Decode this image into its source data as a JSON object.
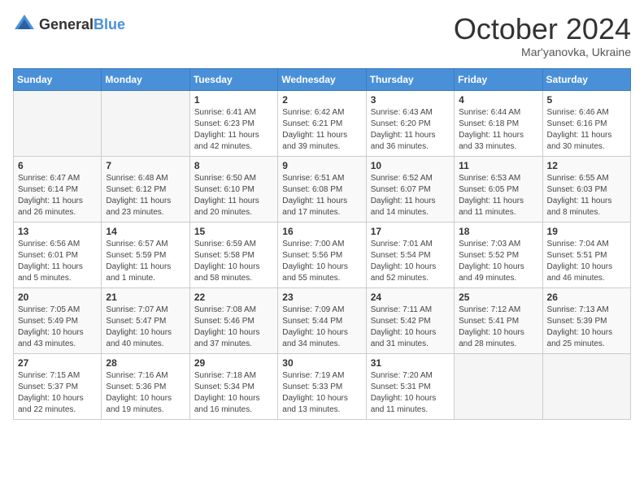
{
  "header": {
    "logo_general": "General",
    "logo_blue": "Blue",
    "month": "October 2024",
    "location": "Mar'yanovka, Ukraine"
  },
  "weekdays": [
    "Sunday",
    "Monday",
    "Tuesday",
    "Wednesday",
    "Thursday",
    "Friday",
    "Saturday"
  ],
  "weeks": [
    [
      {
        "day": "",
        "sunrise": "",
        "sunset": "",
        "daylight": ""
      },
      {
        "day": "",
        "sunrise": "",
        "sunset": "",
        "daylight": ""
      },
      {
        "day": "1",
        "sunrise": "Sunrise: 6:41 AM",
        "sunset": "Sunset: 6:23 PM",
        "daylight": "Daylight: 11 hours and 42 minutes."
      },
      {
        "day": "2",
        "sunrise": "Sunrise: 6:42 AM",
        "sunset": "Sunset: 6:21 PM",
        "daylight": "Daylight: 11 hours and 39 minutes."
      },
      {
        "day": "3",
        "sunrise": "Sunrise: 6:43 AM",
        "sunset": "Sunset: 6:20 PM",
        "daylight": "Daylight: 11 hours and 36 minutes."
      },
      {
        "day": "4",
        "sunrise": "Sunrise: 6:44 AM",
        "sunset": "Sunset: 6:18 PM",
        "daylight": "Daylight: 11 hours and 33 minutes."
      },
      {
        "day": "5",
        "sunrise": "Sunrise: 6:46 AM",
        "sunset": "Sunset: 6:16 PM",
        "daylight": "Daylight: 11 hours and 30 minutes."
      }
    ],
    [
      {
        "day": "6",
        "sunrise": "Sunrise: 6:47 AM",
        "sunset": "Sunset: 6:14 PM",
        "daylight": "Daylight: 11 hours and 26 minutes."
      },
      {
        "day": "7",
        "sunrise": "Sunrise: 6:48 AM",
        "sunset": "Sunset: 6:12 PM",
        "daylight": "Daylight: 11 hours and 23 minutes."
      },
      {
        "day": "8",
        "sunrise": "Sunrise: 6:50 AM",
        "sunset": "Sunset: 6:10 PM",
        "daylight": "Daylight: 11 hours and 20 minutes."
      },
      {
        "day": "9",
        "sunrise": "Sunrise: 6:51 AM",
        "sunset": "Sunset: 6:08 PM",
        "daylight": "Daylight: 11 hours and 17 minutes."
      },
      {
        "day": "10",
        "sunrise": "Sunrise: 6:52 AM",
        "sunset": "Sunset: 6:07 PM",
        "daylight": "Daylight: 11 hours and 14 minutes."
      },
      {
        "day": "11",
        "sunrise": "Sunrise: 6:53 AM",
        "sunset": "Sunset: 6:05 PM",
        "daylight": "Daylight: 11 hours and 11 minutes."
      },
      {
        "day": "12",
        "sunrise": "Sunrise: 6:55 AM",
        "sunset": "Sunset: 6:03 PM",
        "daylight": "Daylight: 11 hours and 8 minutes."
      }
    ],
    [
      {
        "day": "13",
        "sunrise": "Sunrise: 6:56 AM",
        "sunset": "Sunset: 6:01 PM",
        "daylight": "Daylight: 11 hours and 5 minutes."
      },
      {
        "day": "14",
        "sunrise": "Sunrise: 6:57 AM",
        "sunset": "Sunset: 5:59 PM",
        "daylight": "Daylight: 11 hours and 1 minute."
      },
      {
        "day": "15",
        "sunrise": "Sunrise: 6:59 AM",
        "sunset": "Sunset: 5:58 PM",
        "daylight": "Daylight: 10 hours and 58 minutes."
      },
      {
        "day": "16",
        "sunrise": "Sunrise: 7:00 AM",
        "sunset": "Sunset: 5:56 PM",
        "daylight": "Daylight: 10 hours and 55 minutes."
      },
      {
        "day": "17",
        "sunrise": "Sunrise: 7:01 AM",
        "sunset": "Sunset: 5:54 PM",
        "daylight": "Daylight: 10 hours and 52 minutes."
      },
      {
        "day": "18",
        "sunrise": "Sunrise: 7:03 AM",
        "sunset": "Sunset: 5:52 PM",
        "daylight": "Daylight: 10 hours and 49 minutes."
      },
      {
        "day": "19",
        "sunrise": "Sunrise: 7:04 AM",
        "sunset": "Sunset: 5:51 PM",
        "daylight": "Daylight: 10 hours and 46 minutes."
      }
    ],
    [
      {
        "day": "20",
        "sunrise": "Sunrise: 7:05 AM",
        "sunset": "Sunset: 5:49 PM",
        "daylight": "Daylight: 10 hours and 43 minutes."
      },
      {
        "day": "21",
        "sunrise": "Sunrise: 7:07 AM",
        "sunset": "Sunset: 5:47 PM",
        "daylight": "Daylight: 10 hours and 40 minutes."
      },
      {
        "day": "22",
        "sunrise": "Sunrise: 7:08 AM",
        "sunset": "Sunset: 5:46 PM",
        "daylight": "Daylight: 10 hours and 37 minutes."
      },
      {
        "day": "23",
        "sunrise": "Sunrise: 7:09 AM",
        "sunset": "Sunset: 5:44 PM",
        "daylight": "Daylight: 10 hours and 34 minutes."
      },
      {
        "day": "24",
        "sunrise": "Sunrise: 7:11 AM",
        "sunset": "Sunset: 5:42 PM",
        "daylight": "Daylight: 10 hours and 31 minutes."
      },
      {
        "day": "25",
        "sunrise": "Sunrise: 7:12 AM",
        "sunset": "Sunset: 5:41 PM",
        "daylight": "Daylight: 10 hours and 28 minutes."
      },
      {
        "day": "26",
        "sunrise": "Sunrise: 7:13 AM",
        "sunset": "Sunset: 5:39 PM",
        "daylight": "Daylight: 10 hours and 25 minutes."
      }
    ],
    [
      {
        "day": "27",
        "sunrise": "Sunrise: 7:15 AM",
        "sunset": "Sunset: 5:37 PM",
        "daylight": "Daylight: 10 hours and 22 minutes."
      },
      {
        "day": "28",
        "sunrise": "Sunrise: 7:16 AM",
        "sunset": "Sunset: 5:36 PM",
        "daylight": "Daylight: 10 hours and 19 minutes."
      },
      {
        "day": "29",
        "sunrise": "Sunrise: 7:18 AM",
        "sunset": "Sunset: 5:34 PM",
        "daylight": "Daylight: 10 hours and 16 minutes."
      },
      {
        "day": "30",
        "sunrise": "Sunrise: 7:19 AM",
        "sunset": "Sunset: 5:33 PM",
        "daylight": "Daylight: 10 hours and 13 minutes."
      },
      {
        "day": "31",
        "sunrise": "Sunrise: 7:20 AM",
        "sunset": "Sunset: 5:31 PM",
        "daylight": "Daylight: 10 hours and 11 minutes."
      },
      {
        "day": "",
        "sunrise": "",
        "sunset": "",
        "daylight": ""
      },
      {
        "day": "",
        "sunrise": "",
        "sunset": "",
        "daylight": ""
      }
    ]
  ]
}
